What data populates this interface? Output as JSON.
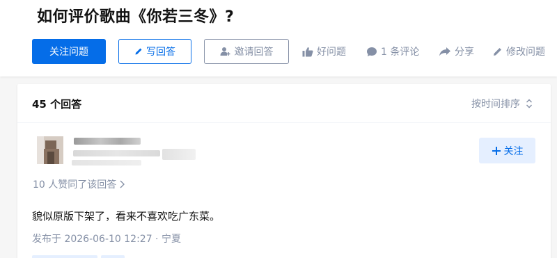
{
  "question": {
    "title": "如何评价歌曲《你若三冬》?"
  },
  "actions": {
    "follow_question": "关注问题",
    "write_answer": "写回答",
    "invite_answer": "邀请回答",
    "good_question": "好问题",
    "comments": "1 条评论",
    "share": "分享",
    "edit_question": "修改问题"
  },
  "answers": {
    "count_label": "45 个回答",
    "sort_label": "按时间排序"
  },
  "answer": {
    "follow_label": "关注",
    "voters_label": "10 人赞同了该回答",
    "content": "貌似原版下架了，看来不喜欢吃广东菜。",
    "meta": "发布于 2026-06-10 12:27 · 宁夏"
  },
  "colors": {
    "brand_blue": "#056de8",
    "muted_gray": "#8590a6",
    "light_blue_bg": "#e5efff"
  },
  "icons": {
    "write": "pen-icon",
    "invite": "user-plus-icon",
    "good": "thumbs-up-icon",
    "comment": "comment-bubble-icon",
    "share": "share-arrow-icon",
    "edit": "pencil-icon",
    "sort": "sort-updown-icon",
    "follow": "plus-icon",
    "voters": "chevron-right-icon"
  }
}
